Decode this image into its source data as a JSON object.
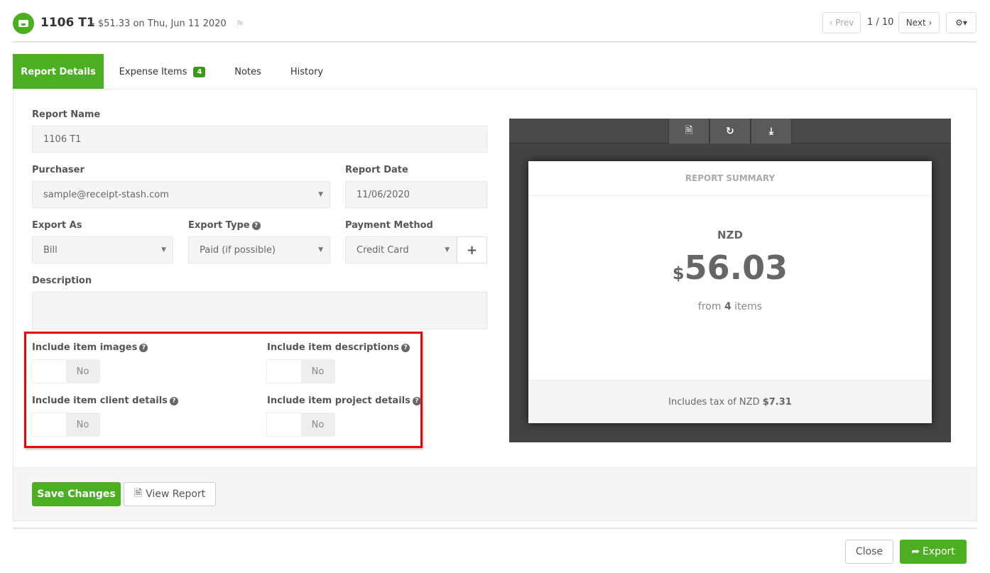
{
  "header": {
    "title": "1106 T1",
    "subtitle": "- $51.33 on Thu, Jun 11 2020",
    "prev": "‹ Prev",
    "page": "1 / 10",
    "next": "Next ›",
    "settings_icon": "gear-icon"
  },
  "tabs": [
    {
      "label": "Report Details",
      "active": true
    },
    {
      "label": "Expense Items",
      "badge": "4"
    },
    {
      "label": "Notes"
    },
    {
      "label": "History"
    }
  ],
  "form": {
    "report_name": {
      "label": "Report Name",
      "value": "1106 T1"
    },
    "purchaser": {
      "label": "Purchaser",
      "value": "sample@receipt-stash.com"
    },
    "report_date": {
      "label": "Report Date",
      "value": "11/06/2020"
    },
    "export_as": {
      "label": "Export As",
      "value": "Bill"
    },
    "export_type": {
      "label": "Export Type",
      "value": "Paid (if possible)"
    },
    "payment_method": {
      "label": "Payment Method",
      "value": "Credit Card",
      "add": "+"
    },
    "description": {
      "label": "Description",
      "value": ""
    },
    "toggles": [
      {
        "label": "Include item images",
        "value": "No"
      },
      {
        "label": "Include item descriptions",
        "value": "No"
      },
      {
        "label": "Include item client details",
        "value": "No"
      },
      {
        "label": "Include item project details",
        "value": "No"
      }
    ]
  },
  "summary": {
    "title": "REPORT SUMMARY",
    "currency": "NZD",
    "symbol": "$",
    "amount": "56.03",
    "from_prefix": "from",
    "count": "4",
    "from_suffix": "items",
    "tax_prefix": "Includes tax of NZD",
    "tax": "$7.31"
  },
  "footer": {
    "save": "Save Changes",
    "view": "View Report",
    "close": "Close",
    "export": "Export"
  },
  "colors": {
    "accent": "#4caf22",
    "highlight": "#ee0000"
  }
}
